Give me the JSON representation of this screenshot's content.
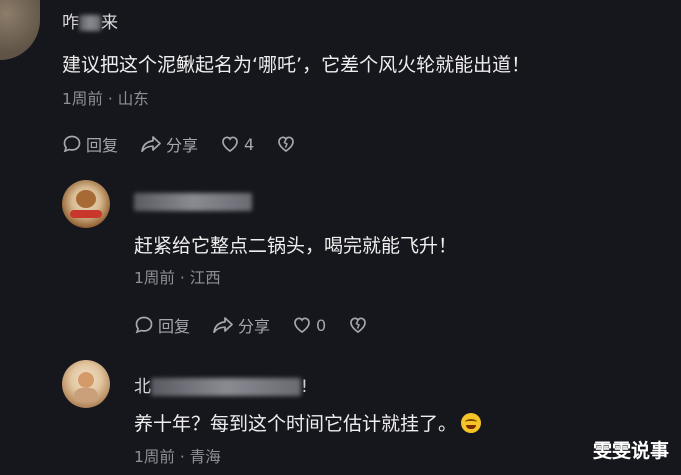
{
  "comments": [
    {
      "username_visible_start": "咋",
      "username_visible_end": "来",
      "text": "建议把这个泥鳅起名为‘哪吒’，它差个风火轮就能出道！",
      "time": "1周前",
      "separator": "·",
      "location": "山东",
      "reply_label": "回复",
      "share_label": "分享",
      "like_count": "4"
    },
    {
      "text": "赶紧给它整点二锅头，喝完就能飞升！",
      "time": "1周前",
      "separator": "·",
      "location": "江西",
      "reply_label": "回复",
      "share_label": "分享",
      "like_count": "0"
    },
    {
      "username_visible_start": "北",
      "username_visible_end": "!",
      "text": "养十年？每到这个时间它估计就挂了。",
      "time": "1周前",
      "separator": "·",
      "location": "青海"
    }
  ],
  "watermark": "雯雯说事",
  "colors": {
    "background": "#16171c",
    "primary_text": "#eeeeef",
    "secondary_text": "#8f9097",
    "action_text": "#a6a7ad"
  }
}
